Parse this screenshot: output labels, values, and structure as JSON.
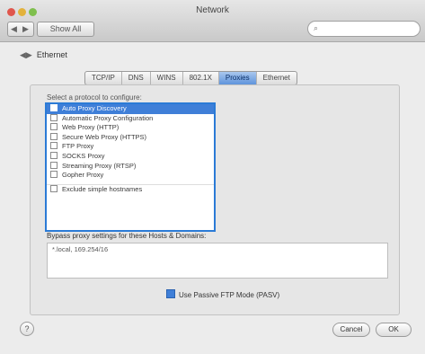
{
  "window": {
    "title": "Network"
  },
  "toolbar": {
    "back_glyph": "◀",
    "forward_glyph": "▶",
    "show_all_label": "Show All",
    "search_placeholder": "",
    "search_icon": "search-icon"
  },
  "adapter": {
    "name": "Ethernet"
  },
  "tabs": [
    "TCP/IP",
    "DNS",
    "WINS",
    "802.1X",
    "Proxies",
    "Ethernet"
  ],
  "active_tab": "Proxies",
  "proxies": {
    "section_label": "Select a protocol to configure:",
    "items": [
      {
        "label": "Auto Proxy Discovery",
        "selected": true,
        "checked": false
      },
      {
        "label": "Automatic Proxy Configuration",
        "selected": false,
        "checked": false
      },
      {
        "label": "Web Proxy (HTTP)",
        "selected": false,
        "checked": false
      },
      {
        "label": "Secure Web Proxy (HTTPS)",
        "selected": false,
        "checked": false
      },
      {
        "label": "FTP Proxy",
        "selected": false,
        "checked": false
      },
      {
        "label": "SOCKS Proxy",
        "selected": false,
        "checked": false
      },
      {
        "label": "Streaming Proxy (RTSP)",
        "selected": false,
        "checked": false
      },
      {
        "label": "Gopher Proxy",
        "selected": false,
        "checked": false
      }
    ],
    "exclude_label": "Exclude simple hostnames"
  },
  "bypass": {
    "label": "Bypass proxy settings for these Hosts & Domains:",
    "value": "*.local, 169.254/16"
  },
  "pasv_label": "Use Passive FTP Mode (PASV)",
  "buttons": {
    "help": "?",
    "cancel": "Cancel",
    "ok": "OK"
  },
  "colors": {
    "selection": "#3f7fd8",
    "highlight_border": "#2b7bd6"
  }
}
